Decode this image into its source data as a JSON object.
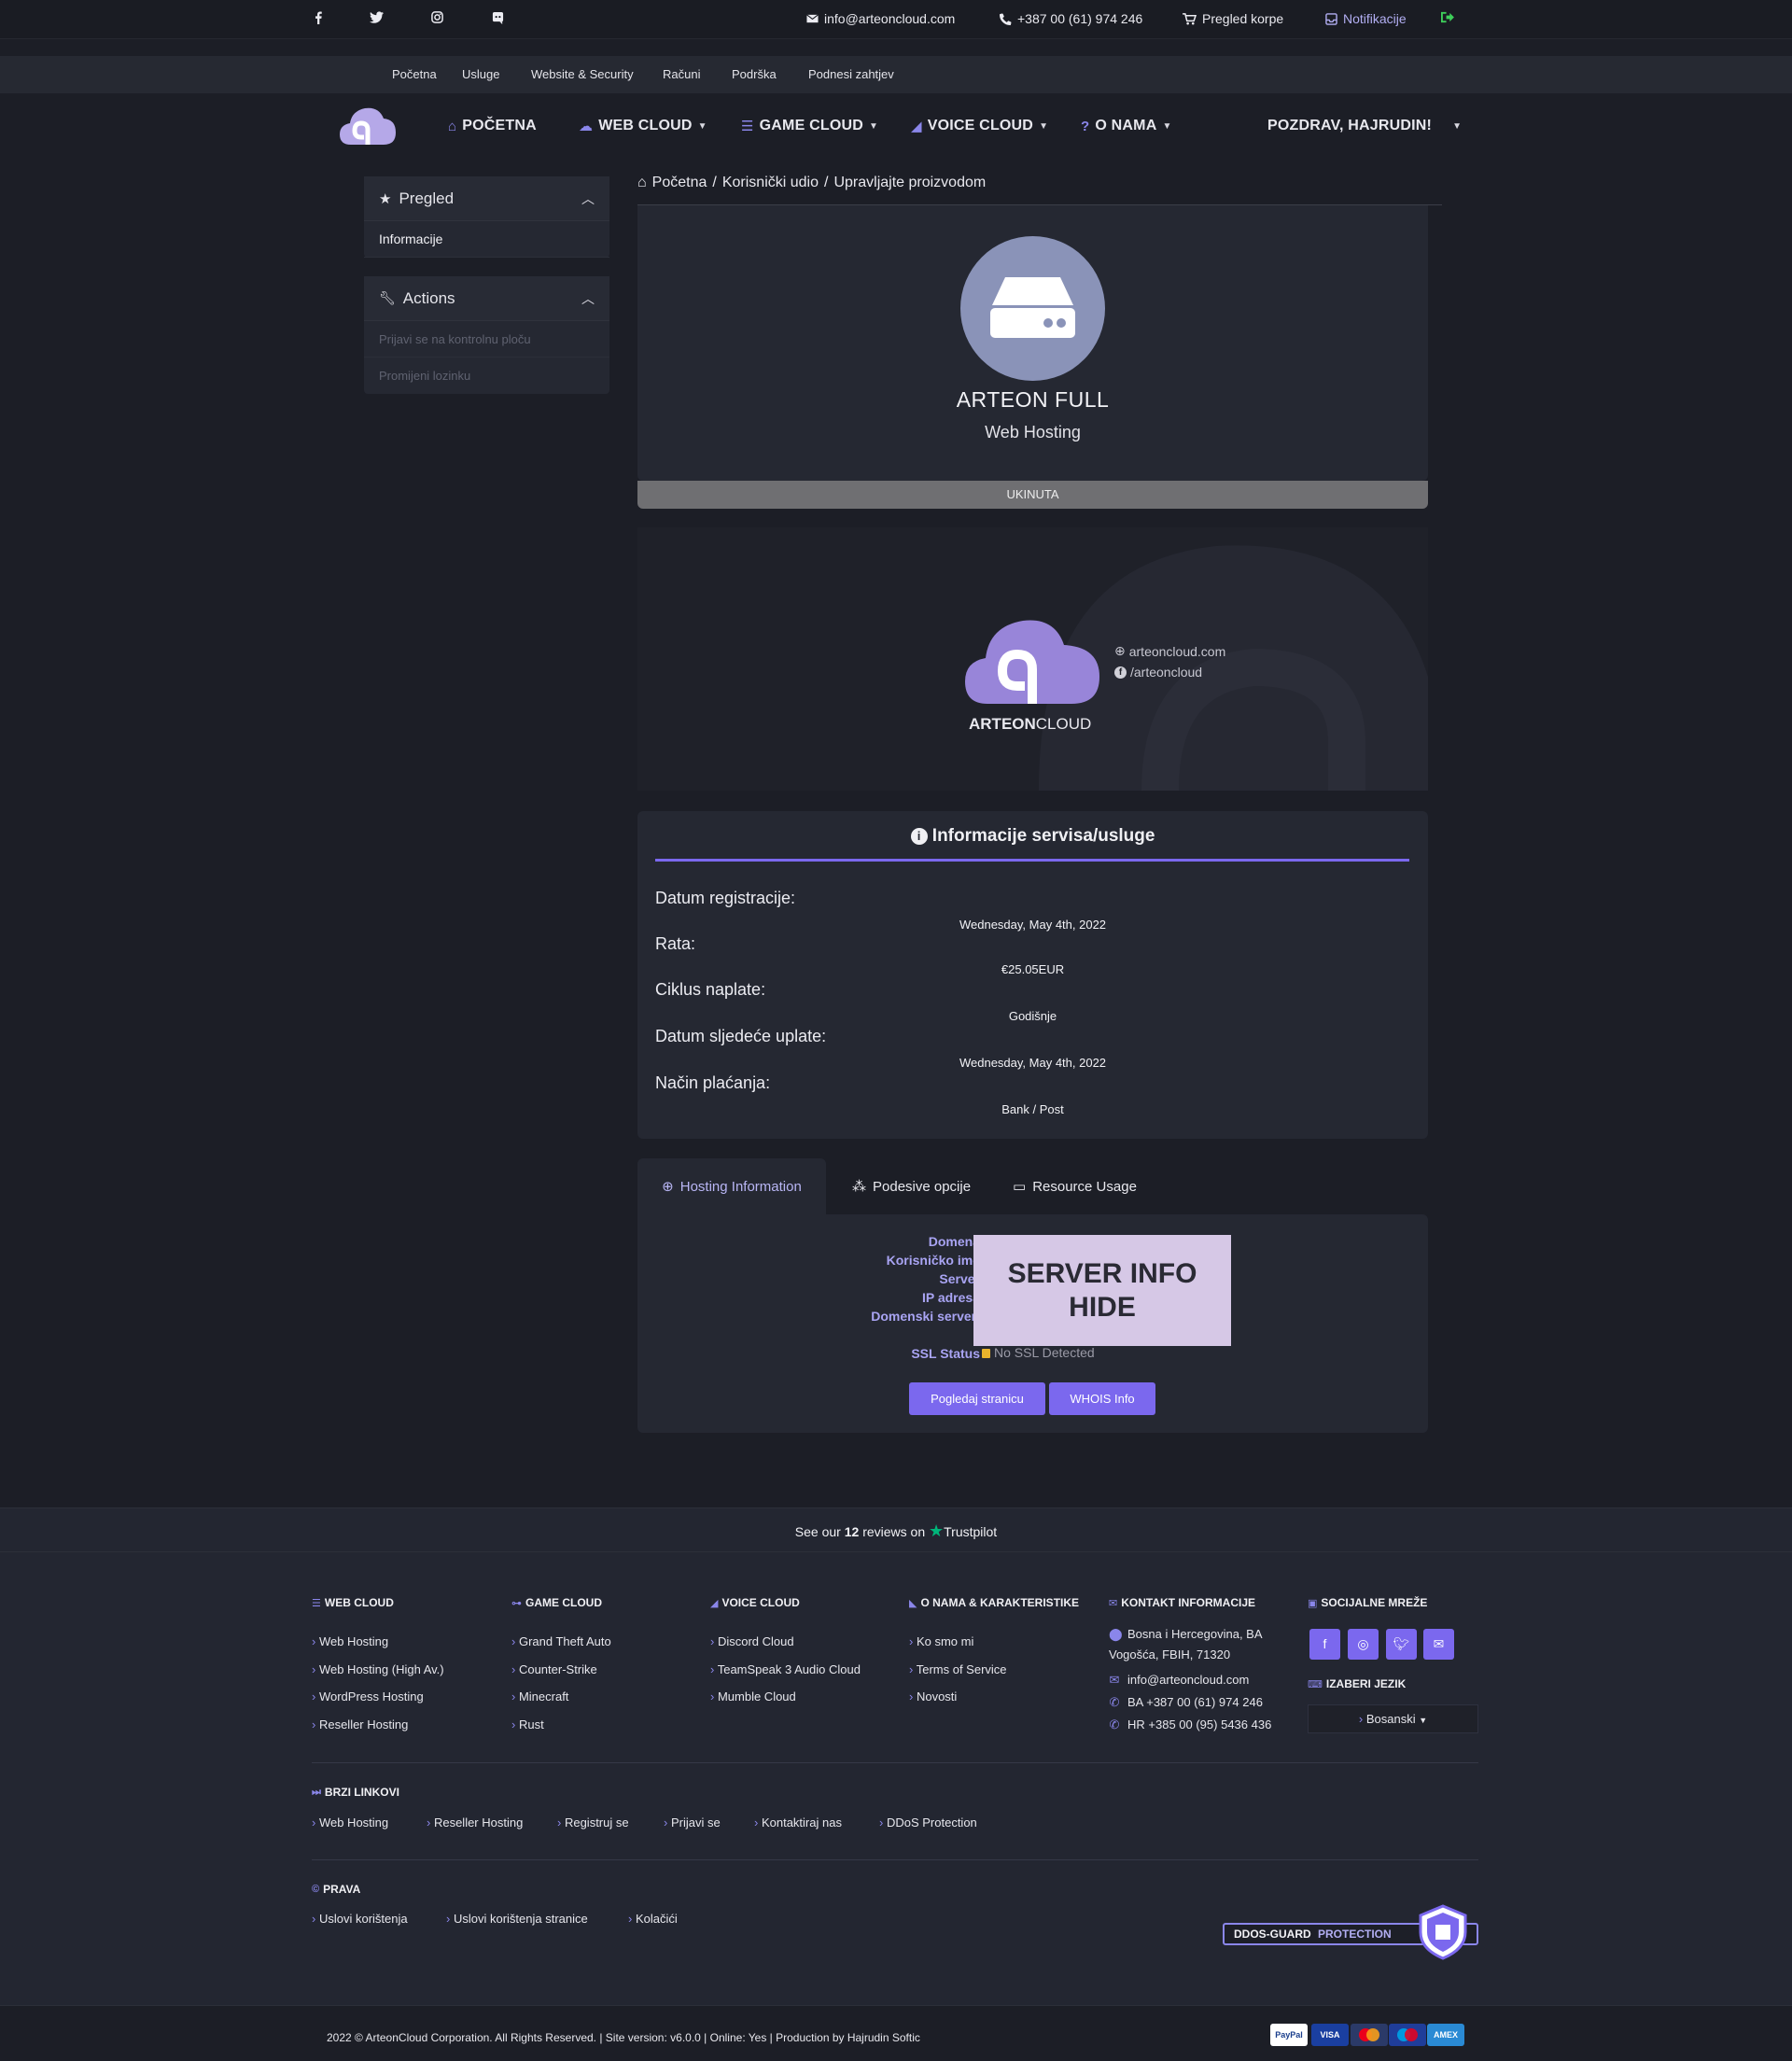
{
  "topbar": {
    "social": [
      "facebook-icon",
      "twitter-icon",
      "instagram-icon",
      "discord-icon"
    ],
    "email": "info@arteoncloud.com",
    "phone": "+387 00 (61) 974 246",
    "cart": "Pregled korpe",
    "notifications": "Notifikacije"
  },
  "linkbar": [
    "Početna",
    "Usluge",
    "Website & Security",
    "Računi",
    "Podrška",
    "Podnesi zahtjev"
  ],
  "nav": {
    "items": [
      "POČETNA",
      "WEB CLOUD",
      "GAME CLOUD",
      "VOICE CLOUD",
      "O NAMA"
    ],
    "greeting": "POZDRAV, HAJRUDIN!"
  },
  "sidebar": {
    "overview": {
      "title": "Pregled",
      "items": [
        "Informacije"
      ]
    },
    "actions": {
      "title": "Actions",
      "items": [
        "Prijavi se na kontrolnu ploču",
        "Promijeni lozinku"
      ]
    }
  },
  "breadcrumb": [
    "Početna",
    "Korisnički udio",
    "Upravljajte proizvodom"
  ],
  "product": {
    "name": "ARTEON FULL",
    "group": "Web Hosting",
    "status": "UKINUTA"
  },
  "banner": {
    "site": "arteoncloud.com",
    "facebook": "/arteoncloud",
    "brand_a": "ARTEON",
    "brand_b": "CLOUD"
  },
  "info": {
    "title": "Informacije servisa/usluge",
    "rows": [
      {
        "label": "Datum registracije:",
        "value": "Wednesday, May 4th, 2022"
      },
      {
        "label": "Rata:",
        "value": "€25.05EUR"
      },
      {
        "label": "Ciklus naplate:",
        "value": "Godišnje"
      },
      {
        "label": "Datum sljedeće uplate:",
        "value": "Wednesday, May 4th, 2022"
      },
      {
        "label": "Način plaćanja:",
        "value": "Bank / Post"
      }
    ]
  },
  "tabs": [
    "Hosting Information",
    "Podesive opcije",
    "Resource Usage"
  ],
  "hosting": {
    "labels": [
      "Domena",
      "Korisničko ime",
      "Server",
      "IP adresa",
      "Domenski serveri"
    ],
    "overlay_line1": "SERVER INFO",
    "overlay_line2": "HIDE",
    "ssl_label": "SSL Status",
    "ssl_value": "No SSL Detected",
    "btn_view": "Pogledaj stranicu",
    "btn_whois": "WHOIS Info"
  },
  "trustpilot": {
    "pre": "See our",
    "count": "12",
    "mid": "reviews on",
    "brand": "Trustpilot"
  },
  "footer": {
    "web_cloud": {
      "title": "WEB CLOUD",
      "links": [
        "Web Hosting",
        "Web Hosting (High Av.)",
        "WordPress Hosting",
        "Reseller Hosting"
      ]
    },
    "game_cloud": {
      "title": "GAME CLOUD",
      "links": [
        "Grand Theft Auto",
        "Counter-Strike",
        "Minecraft",
        "Rust"
      ]
    },
    "voice_cloud": {
      "title": "VOICE CLOUD",
      "links": [
        "Discord Cloud",
        "TeamSpeak 3 Audio Cloud",
        "Mumble Cloud"
      ]
    },
    "about": {
      "title": "O NAMA & KARAKTERISTIKE",
      "links": [
        "Ko smo mi",
        "Terms of Service",
        "Novosti"
      ]
    },
    "contact": {
      "title": "KONTAKT INFORMACIJE",
      "address1": "Bosna i Hercegovina, BA",
      "address2": "Vogošća, FBIH, 71320",
      "email": "info@arteoncloud.com",
      "phone_ba": "BA +387 00 (61) 974 246",
      "phone_hr": "HR +385 00 (95) 5436 436"
    },
    "social": {
      "title": "SOCIJALNE MREŽE",
      "icons": [
        "facebook-icon",
        "instagram-icon",
        "twitter-icon",
        "envelope-icon"
      ]
    },
    "language": {
      "title": "IZABERI JEZIK",
      "selected": "Bosanski"
    },
    "quick": {
      "title": "BRZI LINKOVI",
      "links": [
        "Web Hosting",
        "Reseller Hosting",
        "Registruj se",
        "Prijavi se",
        "Kontaktiraj nas",
        "DDoS Protection"
      ]
    },
    "rights": {
      "title": "PRAVA",
      "links": [
        "Uslovi korištenja",
        "Uslovi korištenja stranice",
        "Kolačići"
      ]
    },
    "ddos_a": "DDOS-GUARD",
    "ddos_b": "PROTECTION",
    "copyright": "2022 © ArteonCloud Corporation. All Rights Reserved. | Site version: v6.0.0 | Online: Yes | Production by Hajrudin Softic",
    "payments": [
      "PayPal",
      "VISA",
      "MC",
      "Maestro",
      "AMEX"
    ]
  },
  "colors": {
    "accent": "#7b68ee",
    "background": "#1c1e26",
    "card": "#252832",
    "status_cancelled": "#6f6f72"
  }
}
